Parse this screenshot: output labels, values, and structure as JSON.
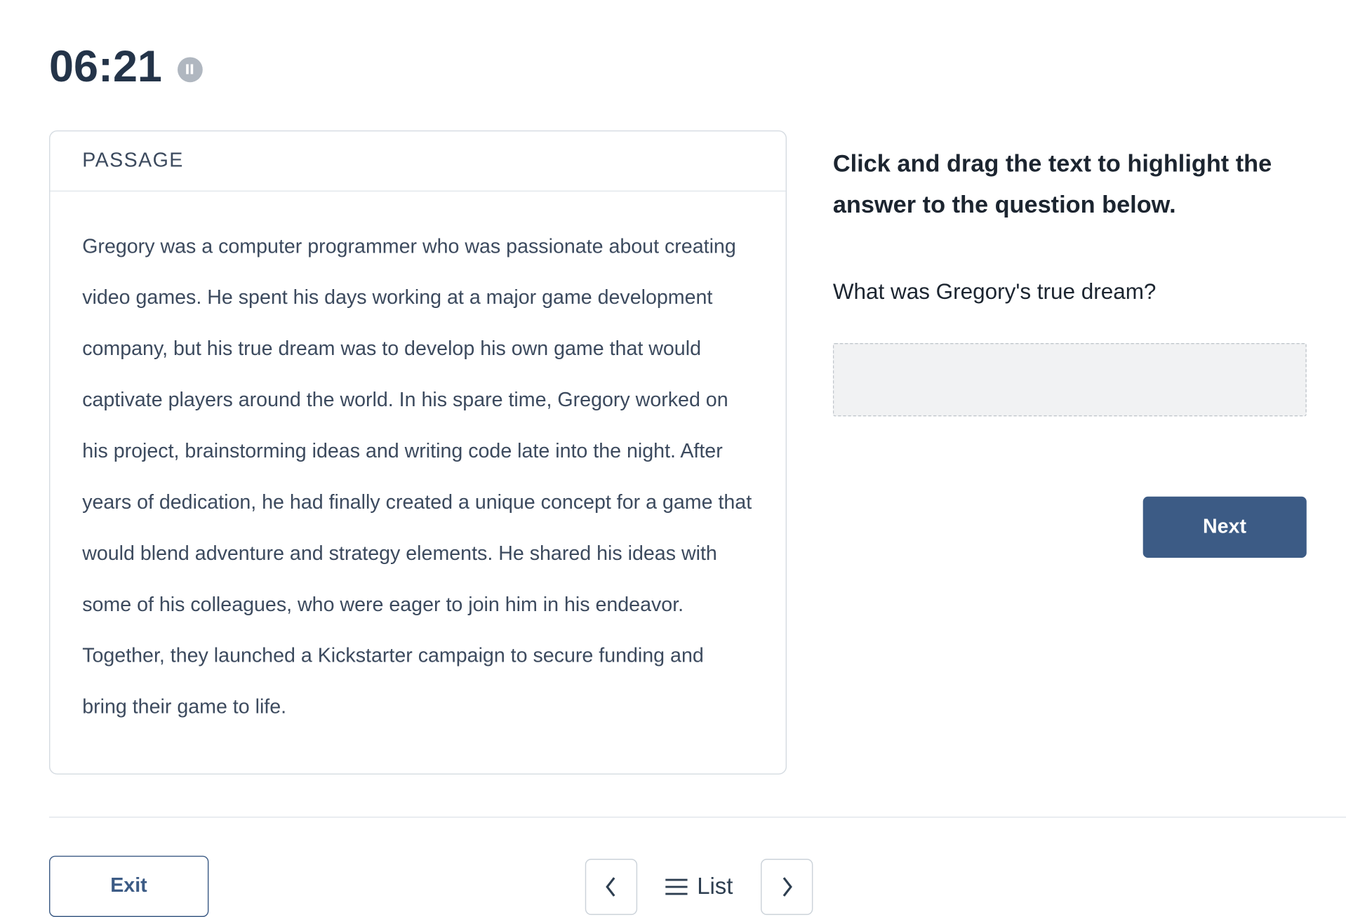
{
  "header": {
    "timer": "06:21"
  },
  "passage": {
    "label": "PASSAGE",
    "text": "Gregory was a computer programmer who was passionate about creating video games. He spent his days working at a major game development company, but his true dream was to develop his own game that would captivate players around the world. In his spare time, Gregory worked on his project, brainstorming ideas and writing code late into the night. After years of dedication, he had finally created a unique concept for a game that would blend adventure and strategy elements. He shared his ideas with some of his colleagues, who were eager to join him in his endeavor. Together, they launched a Kickstarter campaign to secure funding and bring their game to life."
  },
  "right": {
    "instruction": "Click and drag the text to highlight the answer to the question below.",
    "question": "What was Gregory's true dream?",
    "next_label": "Next"
  },
  "footer": {
    "exit_label": "Exit",
    "list_label": "List"
  }
}
